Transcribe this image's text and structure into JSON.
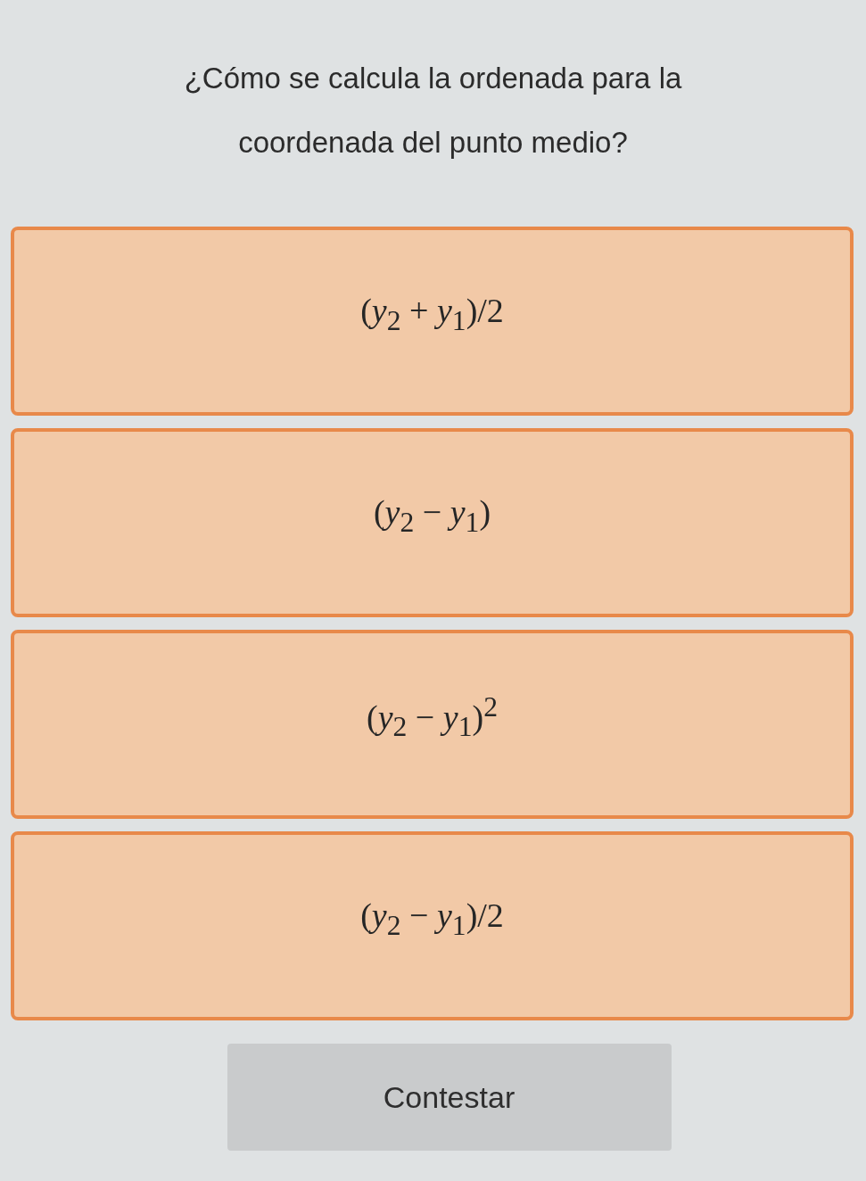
{
  "question": "¿Cómo se calcula la ordenada para la coordenada del punto medio?",
  "options": [
    {
      "text": "(*y*$_{2}$ + *y*$_{1}$)/2",
      "selected": false
    },
    {
      "text": "(*y*$_{2}$ − *y*$_{1}$)",
      "selected": false
    },
    {
      "text": "(*y*$_{2}$ − *y*$_{1}$)$^{2}$",
      "selected": false
    },
    {
      "text": "(*y*$_{2}$ − *y*$_{1}$)/2",
      "selected": false
    }
  ],
  "submit": {
    "label": "Contestar",
    "disabled": true
  }
}
